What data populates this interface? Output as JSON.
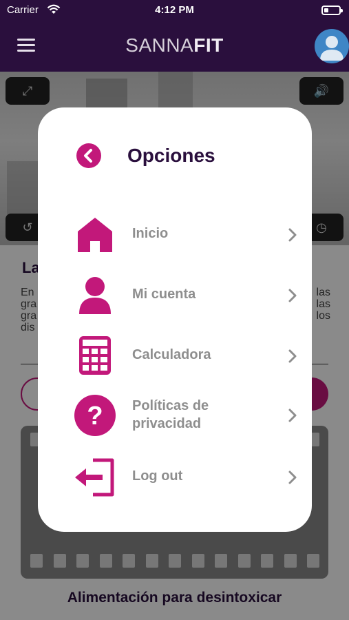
{
  "status_bar": {
    "carrier": "Carrier",
    "time": "4:12 PM"
  },
  "nav": {
    "brand_light": "SANNA",
    "brand_bold": "FIT"
  },
  "background": {
    "title_fragment": "La",
    "text_left": [
      "En",
      "gra",
      "gra",
      "dis"
    ],
    "text_right": [
      "las",
      "las",
      "los"
    ],
    "footer_title": "Alimentación para desintoxicar"
  },
  "modal": {
    "title": "Opciones",
    "items": [
      {
        "label": "Inicio",
        "icon": "home-icon"
      },
      {
        "label": "Mi cuenta",
        "icon": "user-icon"
      },
      {
        "label": "Calculadora",
        "icon": "calculator-icon"
      },
      {
        "label": "Políticas de\nprivacidad",
        "icon": "question-icon"
      },
      {
        "label": "Log out",
        "icon": "logout-icon"
      }
    ]
  },
  "colors": {
    "brand_dark": "#2a0f3d",
    "accent": "#c2187a",
    "label_gray": "#8e8e8e"
  }
}
